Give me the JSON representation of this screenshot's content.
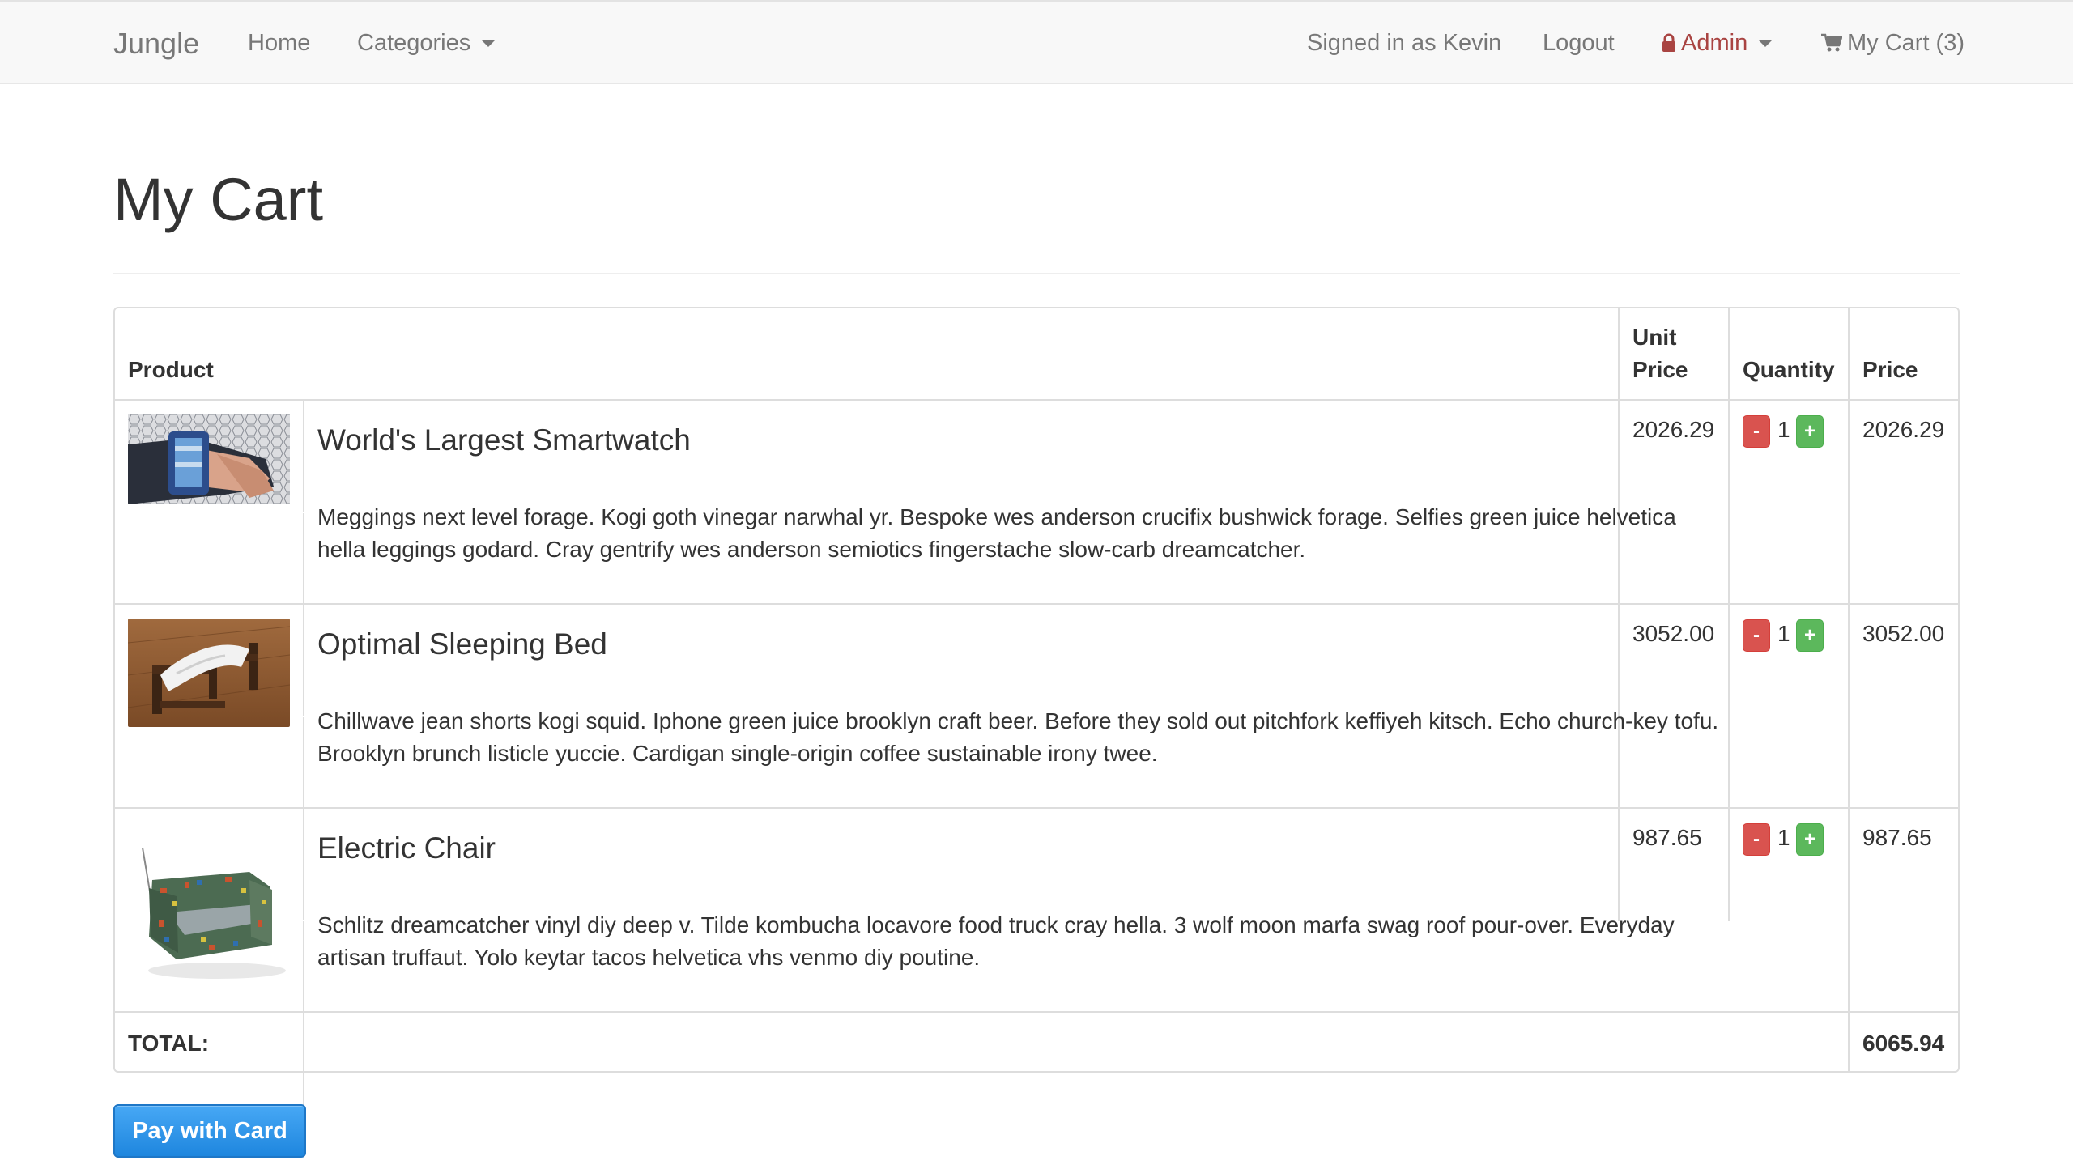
{
  "navbar": {
    "brand": "Jungle",
    "home": "Home",
    "categories": "Categories",
    "signed_in": "Signed in as Kevin",
    "logout": "Logout",
    "admin": "Admin",
    "cart": "My Cart (3)",
    "admin_color": "#a94442"
  },
  "page": {
    "title": "My Cart"
  },
  "table": {
    "headers": {
      "product": "Product",
      "unit_price_line1": "Unit",
      "unit_price_line2": "Price",
      "quantity": "Quantity",
      "price": "Price"
    },
    "rows": [
      {
        "name": "World's Largest Smartwatch",
        "description": "Meggings next level forage. Kogi goth vinegar narwhal yr. Bespoke wes anderson crucifix bushwick forage. Selfies green juice helvetica hella leggings godard. Cray gentrify wes anderson semiotics fingerstache slow-carb dreamcatcher.",
        "unit_price": "2026.29",
        "quantity": "1",
        "price": "2026.29",
        "minus_label": "-",
        "plus_label": "+"
      },
      {
        "name": "Optimal Sleeping Bed",
        "description": "Chillwave jean shorts kogi squid. Iphone green juice brooklyn craft beer. Before they sold out pitchfork keffiyeh kitsch. Echo church-key tofu. Brooklyn brunch listicle yuccie. Cardigan single-origin coffee sustainable irony twee.",
        "unit_price": "3052.00",
        "quantity": "1",
        "price": "3052.00",
        "minus_label": "-",
        "plus_label": "+"
      },
      {
        "name": "Electric Chair",
        "description": "Schlitz dreamcatcher vinyl diy deep v. Tilde kombucha locavore food truck cray hella. 3 wolf moon marfa swag roof pour-over. Everyday artisan truffaut. Yolo keytar tacos helvetica vhs venmo diy poutine.",
        "unit_price": "987.65",
        "quantity": "1",
        "price": "987.65",
        "minus_label": "-",
        "plus_label": "+"
      }
    ],
    "total_label": "TOTAL:",
    "total_value": "6065.94"
  },
  "pay_button": {
    "label": "Pay with Card",
    "color": "#1e86de"
  }
}
